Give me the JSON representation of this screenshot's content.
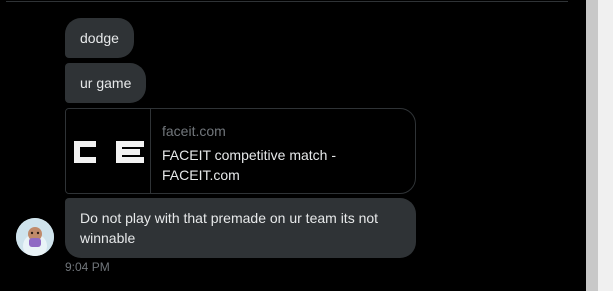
{
  "conversation": {
    "messages": [
      {
        "text": "dodge"
      },
      {
        "text": "ur game"
      },
      {
        "text": "Do not play with that premade on ur team its not winnable"
      }
    ],
    "link_card": {
      "domain": "faceit.com",
      "title": "FACEIT competitive match - FACEIT.com",
      "thumbnail_text": "C E"
    },
    "timestamp": "9:04 PM"
  },
  "icons": {
    "avatar": "user-avatar-icon"
  },
  "colors": {
    "background": "#000000",
    "bubble": "#2f3336",
    "text": "#e7e9ea",
    "muted_text": "#71767b"
  }
}
